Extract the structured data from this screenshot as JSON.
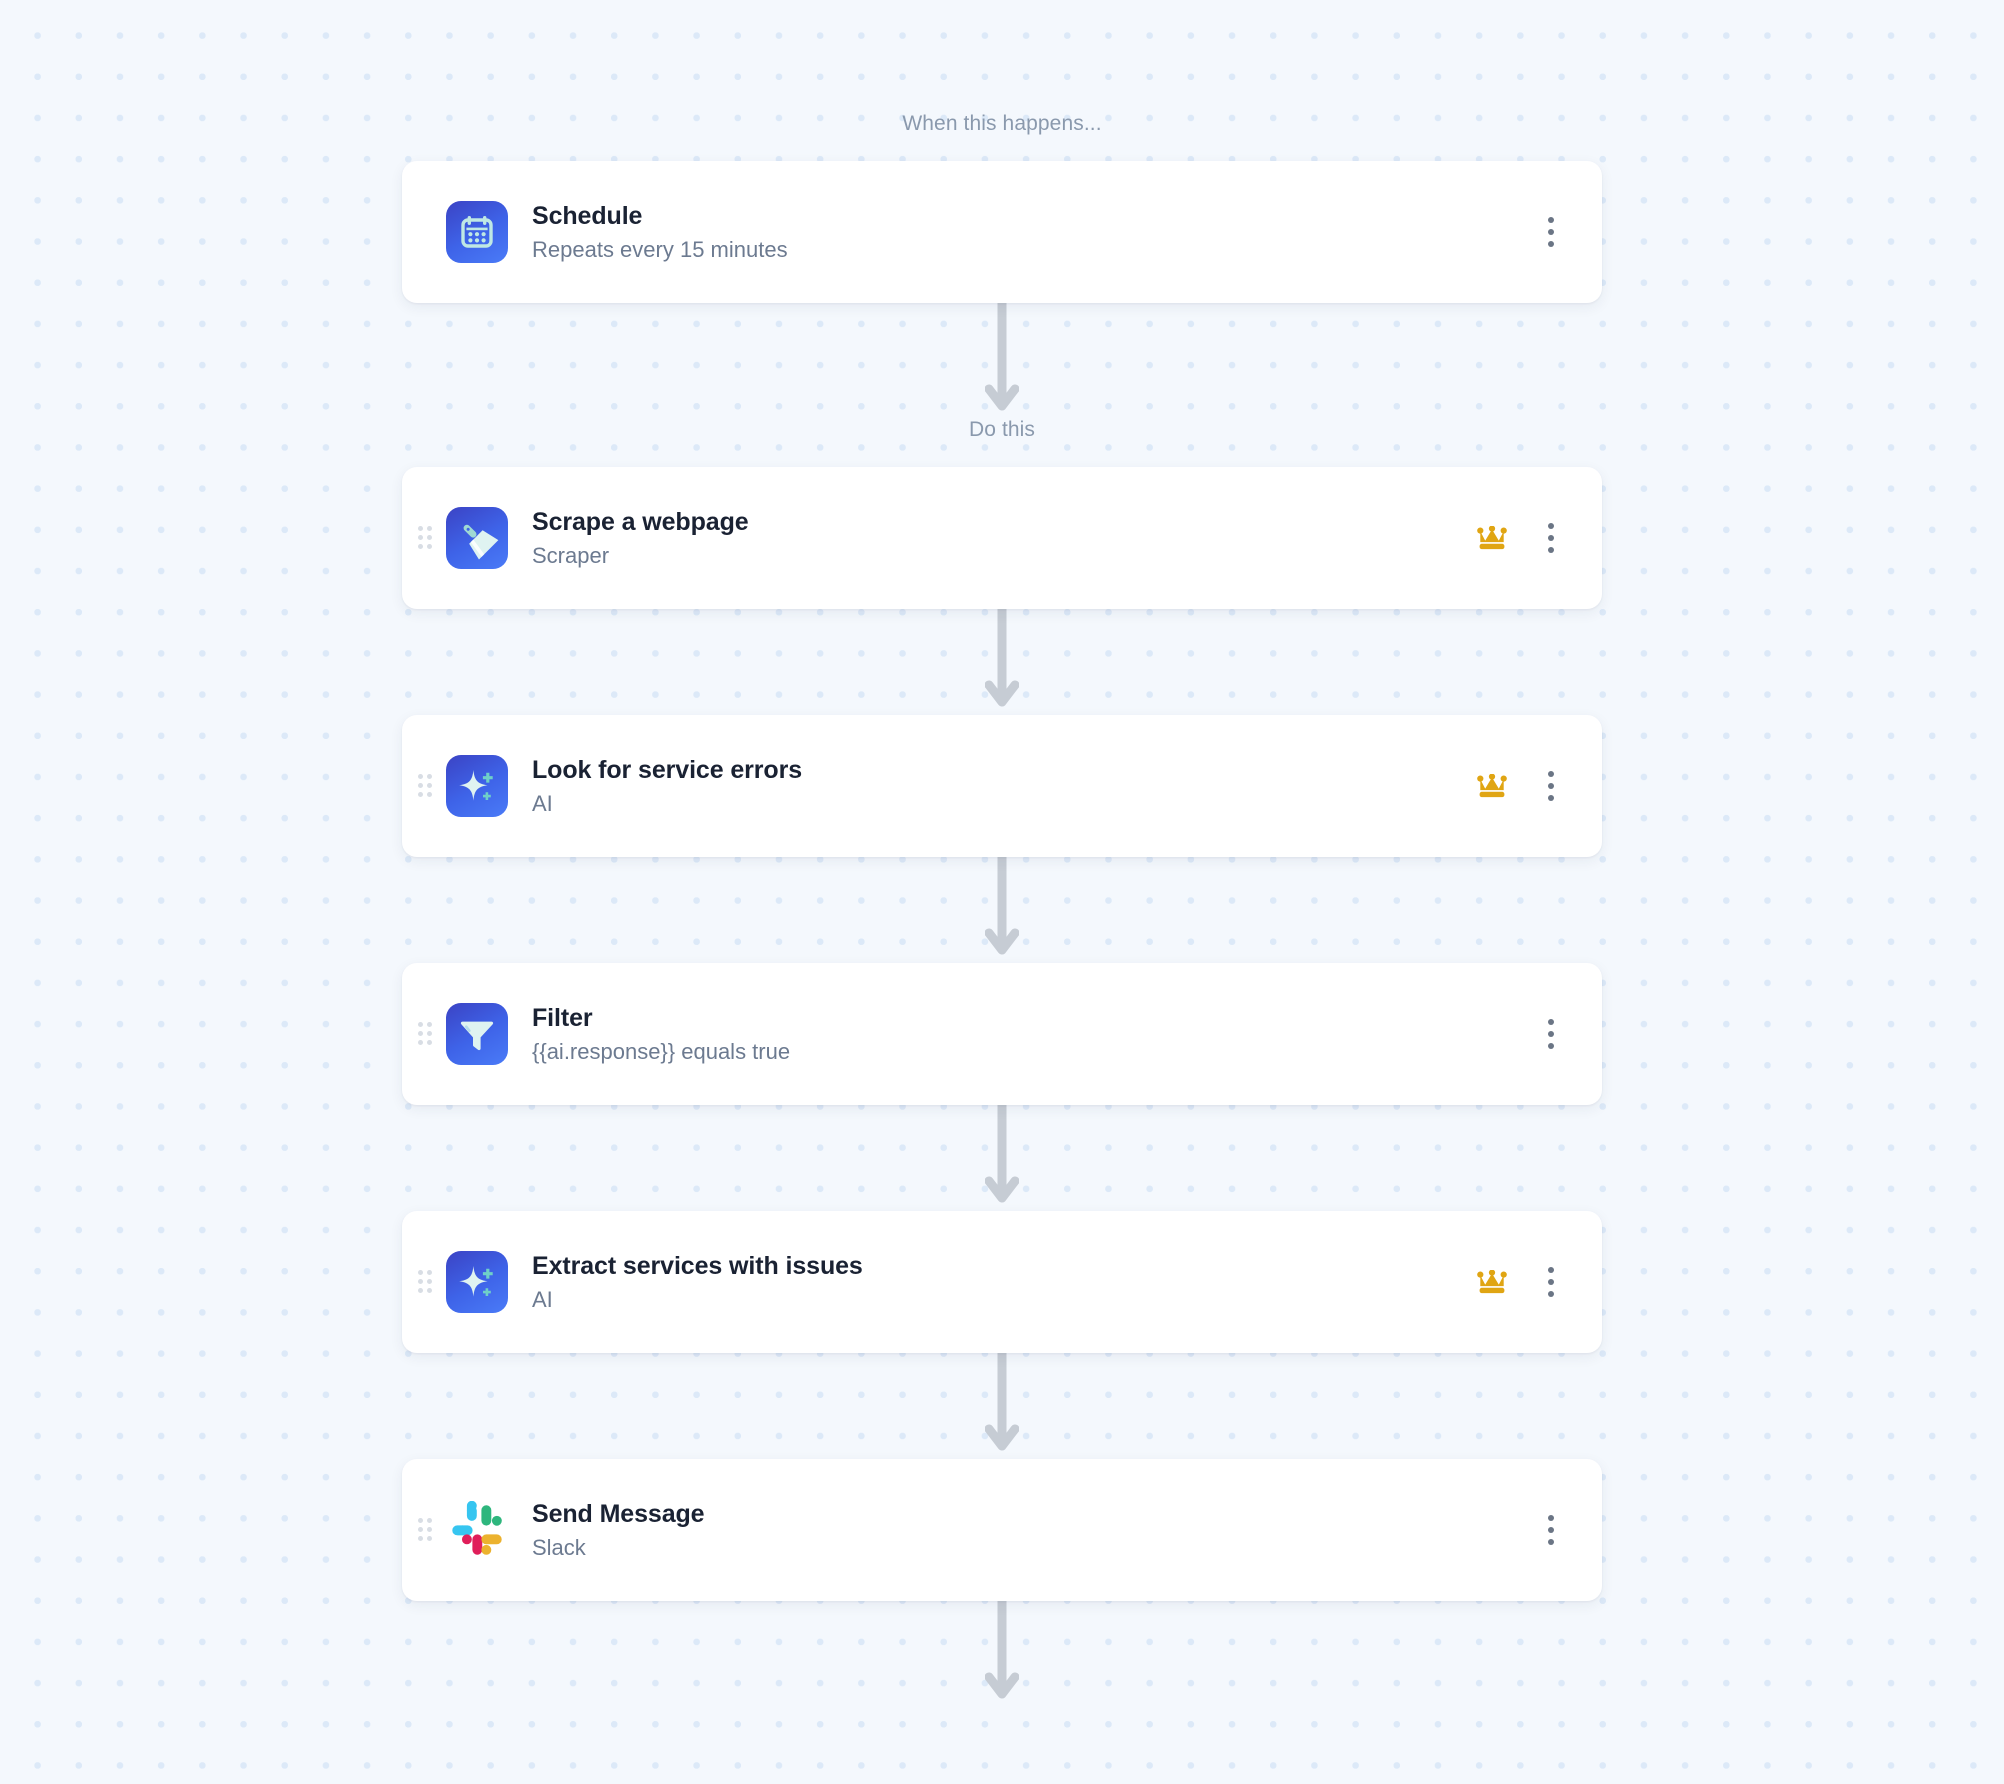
{
  "canvas": {
    "background_color": "#F4F8FD",
    "dot_color": "#DCE9F8"
  },
  "labels": {
    "trigger_caption": "When this happens...",
    "action_caption": "Do this"
  },
  "colors": {
    "card_bg": "#FFFFFF",
    "title": "#1A2233",
    "subtitle": "#6C7A90",
    "caption": "#8A99AD",
    "icon_tile_gradient_start": "#3B43C4",
    "icon_tile_gradient_end": "#4A7BF7",
    "icon_glyph": "#C4EAE6",
    "crown": "#E0A513",
    "arrow": "#C6CCD4",
    "drag_dot": "#D8DDE4",
    "slack_blue": "#36C5F0",
    "slack_green": "#2EB67D",
    "slack_red": "#E01E5A",
    "slack_yellow": "#ECB22E"
  },
  "steps": [
    {
      "title": "Schedule",
      "subtitle": "Repeats every 15 minutes",
      "icon": "calendar-icon",
      "kind": "trigger",
      "premium": false,
      "draggable": false
    },
    {
      "title": "Scrape a webpage",
      "subtitle": "Scraper",
      "icon": "scraper-icon",
      "kind": "action",
      "premium": true,
      "draggable": true
    },
    {
      "title": "Look for service errors",
      "subtitle": "AI",
      "icon": "ai-sparkle-icon",
      "kind": "action",
      "premium": true,
      "draggable": true
    },
    {
      "title": "Filter",
      "subtitle": "{{ai.response}} equals true",
      "icon": "filter-funnel-icon",
      "kind": "action",
      "premium": false,
      "draggable": true
    },
    {
      "title": "Extract services with issues",
      "subtitle": "AI",
      "icon": "ai-sparkle-icon",
      "kind": "action",
      "premium": true,
      "draggable": true
    },
    {
      "title": "Send Message",
      "subtitle": "Slack",
      "icon": "slack-icon",
      "kind": "action",
      "premium": false,
      "draggable": true
    }
  ],
  "menu": {
    "kebab_label": "More options"
  },
  "premium": {
    "badge_label": "Premium"
  }
}
